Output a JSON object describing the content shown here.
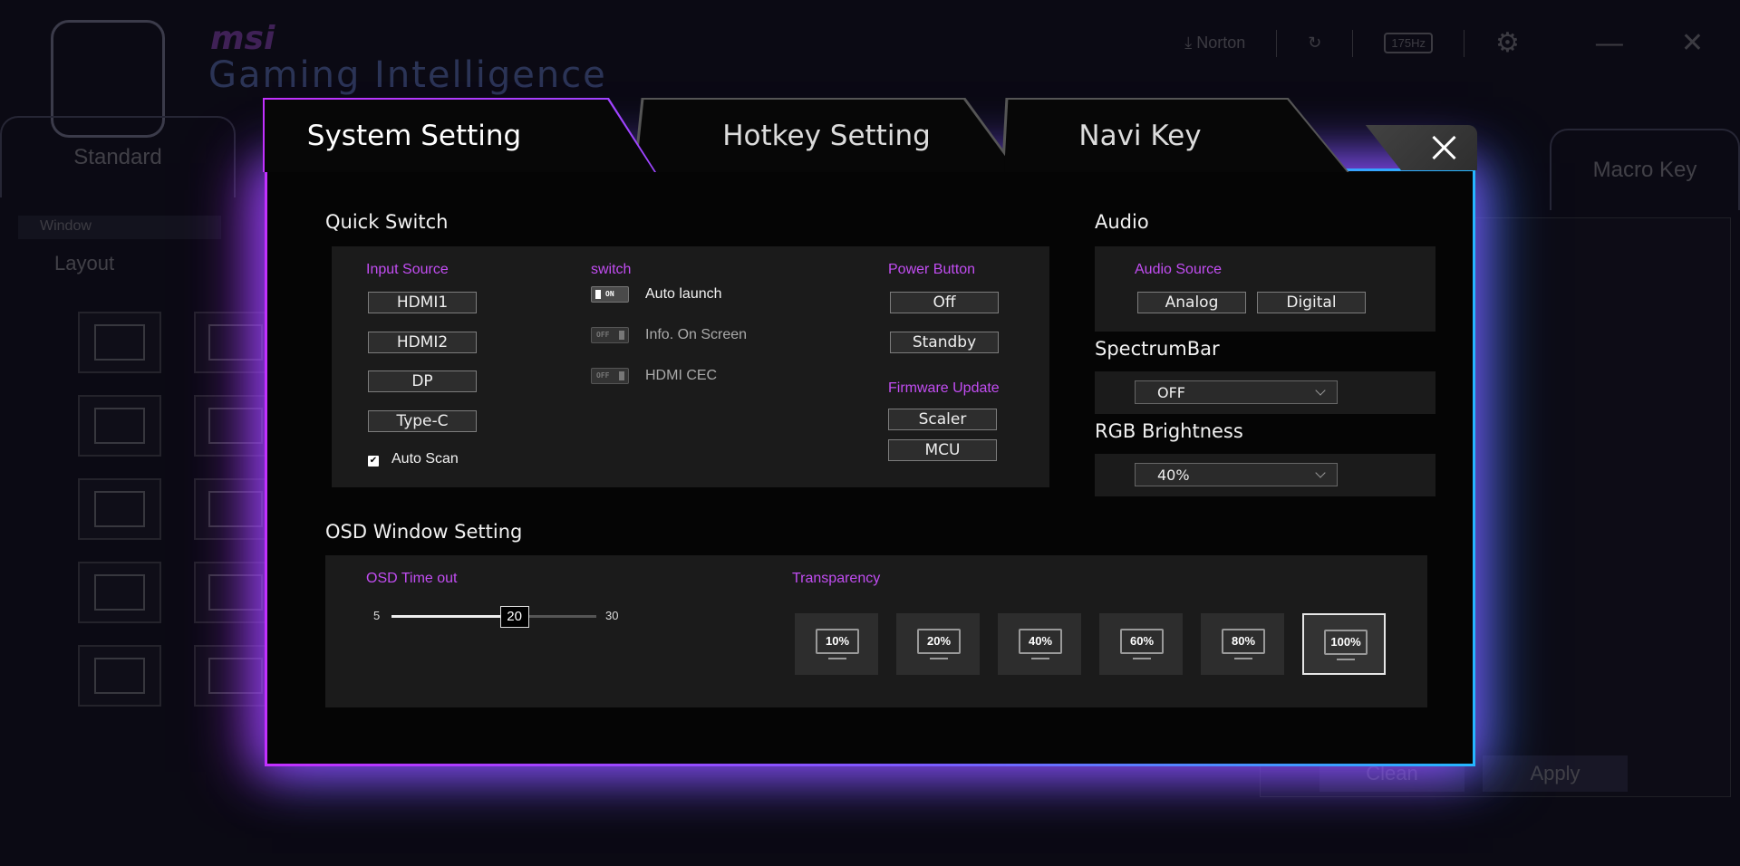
{
  "background": {
    "brand": "msi",
    "subbrand": "Gaming Intelligence",
    "top_right": {
      "norton": "Norton",
      "hz": "175Hz"
    },
    "tab_standard": "Standard",
    "tab_macro": "Macro Key",
    "window_label": "Window",
    "layout_label": "Layout",
    "clean_label": "Clean",
    "apply_label": "Apply"
  },
  "tabs": {
    "system": "System Setting",
    "hotkey": "Hotkey Setting",
    "navi": "Navi Key"
  },
  "quick_switch": {
    "title": "Quick Switch",
    "input_source_label": "Input Source",
    "inputs": [
      "HDMI1",
      "HDMI2",
      "DP",
      "Type-C"
    ],
    "auto_scan_label": "Auto Scan",
    "auto_scan_checked": true,
    "switch_label": "switch",
    "toggles": [
      {
        "label": "Auto launch",
        "state": "ON"
      },
      {
        "label": "Info. On Screen",
        "state": "OFF"
      },
      {
        "label": "HDMI CEC",
        "state": "OFF"
      }
    ],
    "power_button_label": "Power Button",
    "power_options": [
      "Off",
      "Standby"
    ],
    "firmware_label": "Firmware Update",
    "firmware_options": [
      "Scaler",
      "MCU"
    ]
  },
  "audio": {
    "title": "Audio",
    "source_label": "Audio Source",
    "analog": "Analog",
    "digital": "Digital"
  },
  "spectrum": {
    "title": "SpectrumBar",
    "value": "OFF"
  },
  "rgb": {
    "title": "RGB Brightness",
    "value": "40%"
  },
  "osd": {
    "title": "OSD Window Setting",
    "timeout_label": "OSD Time out",
    "min": "5",
    "max": "30",
    "value": "20",
    "transparency_label": "Transparency",
    "transparency_options": [
      "10%",
      "20%",
      "40%",
      "60%",
      "80%",
      "100%"
    ],
    "transparency_selected": "100%"
  }
}
